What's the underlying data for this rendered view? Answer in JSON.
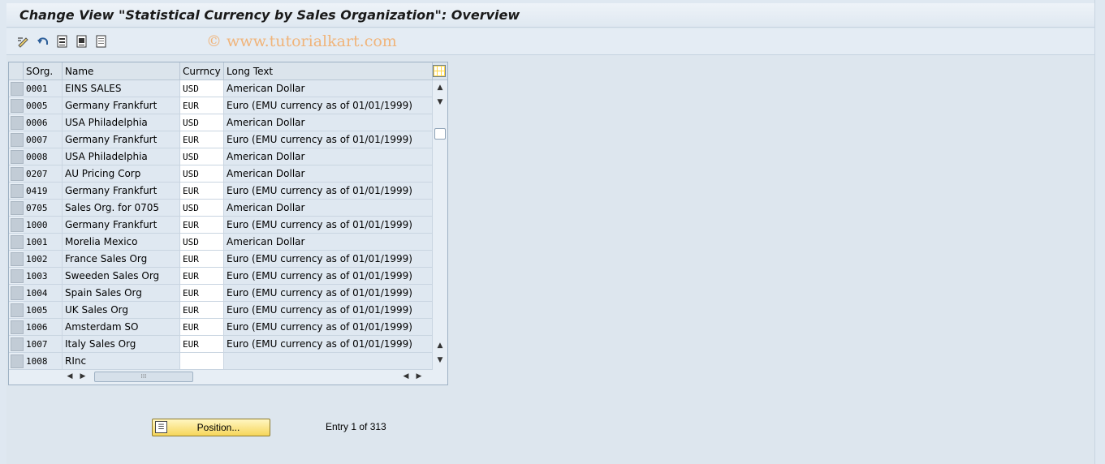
{
  "window": {
    "title": "Change View \"Statistical Currency by Sales Organization\": Overview"
  },
  "toolbar": {
    "watermark": "© www.tutorialkart.com",
    "icons": [
      "display-change-icon",
      "undo-icon",
      "select-all-icon",
      "select-block-icon",
      "deselect-all-icon"
    ]
  },
  "table": {
    "columns": [
      "SOrg.",
      "Name",
      "Currncy",
      "Long Text"
    ],
    "rows": [
      {
        "sorg": "0001",
        "name": "EINS SALES",
        "currency": "USD",
        "long_text": "American Dollar"
      },
      {
        "sorg": "0005",
        "name": "Germany Frankfurt",
        "currency": "EUR",
        "long_text": "Euro (EMU currency as of 01/01/1999)"
      },
      {
        "sorg": "0006",
        "name": "USA Philadelphia",
        "currency": "USD",
        "long_text": "American Dollar"
      },
      {
        "sorg": "0007",
        "name": "Germany Frankfurt",
        "currency": "EUR",
        "long_text": "Euro (EMU currency as of 01/01/1999)"
      },
      {
        "sorg": "0008",
        "name": "USA Philadelphia",
        "currency": "USD",
        "long_text": "American Dollar"
      },
      {
        "sorg": "0207",
        "name": "AU Pricing Corp",
        "currency": "USD",
        "long_text": "American Dollar"
      },
      {
        "sorg": "0419",
        "name": "Germany Frankfurt",
        "currency": "EUR",
        "long_text": "Euro (EMU currency as of 01/01/1999)"
      },
      {
        "sorg": "0705",
        "name": "Sales Org. for 0705",
        "currency": "USD",
        "long_text": "American Dollar"
      },
      {
        "sorg": "1000",
        "name": "Germany Frankfurt",
        "currency": "EUR",
        "long_text": "Euro (EMU currency as of 01/01/1999)"
      },
      {
        "sorg": "1001",
        "name": "Morelia Mexico",
        "currency": "USD",
        "long_text": "American Dollar"
      },
      {
        "sorg": "1002",
        "name": "France Sales Org",
        "currency": "EUR",
        "long_text": "Euro (EMU currency as of 01/01/1999)"
      },
      {
        "sorg": "1003",
        "name": "Sweeden Sales Org",
        "currency": "EUR",
        "long_text": "Euro (EMU currency as of 01/01/1999)"
      },
      {
        "sorg": "1004",
        "name": "Spain Sales Org",
        "currency": "EUR",
        "long_text": "Euro (EMU currency as of 01/01/1999)"
      },
      {
        "sorg": "1005",
        "name": "UK Sales Org",
        "currency": "EUR",
        "long_text": "Euro (EMU currency as of 01/01/1999)"
      },
      {
        "sorg": "1006",
        "name": "Amsterdam SO",
        "currency": "EUR",
        "long_text": "Euro (EMU currency as of 01/01/1999)"
      },
      {
        "sorg": "1007",
        "name": "Italy Sales Org",
        "currency": "EUR",
        "long_text": "Euro (EMU currency as of 01/01/1999)"
      },
      {
        "sorg": "1008",
        "name": "RInc",
        "currency": "",
        "long_text": ""
      }
    ]
  },
  "footer": {
    "position_button": "Position...",
    "entry_info": "Entry 1 of 313"
  }
}
